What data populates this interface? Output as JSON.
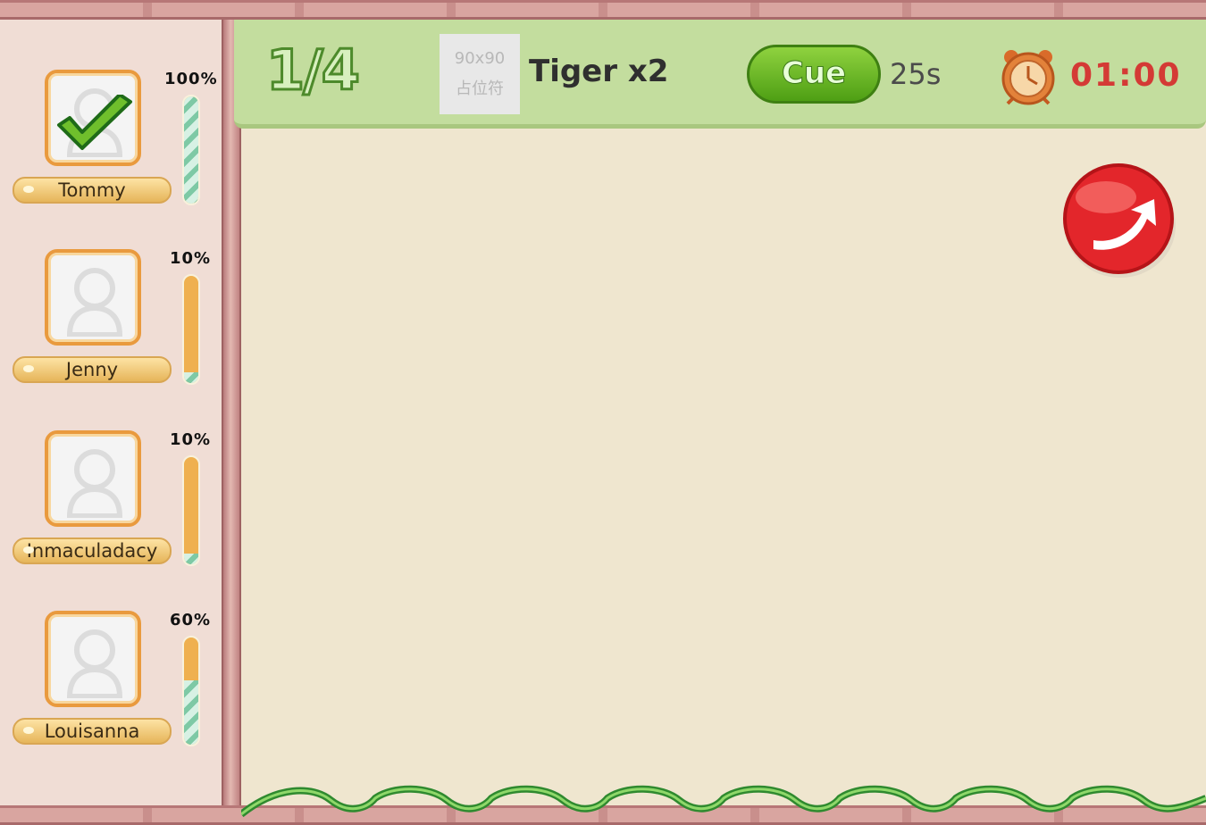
{
  "header": {
    "progress": "1/4",
    "placeholder_line1": "90x90",
    "placeholder_line2": "占位符",
    "word": "Tiger x2",
    "cue_label": "Cue",
    "cue_count": "25s",
    "timer": "01:00",
    "clock_icon": "alarm-clock-icon",
    "exit_icon": "exit-arrow-icon"
  },
  "players": [
    {
      "name": "Tommy",
      "percent_label": "100%",
      "progress": 1.0,
      "done": true
    },
    {
      "name": "Jenny",
      "percent_label": "10%",
      "progress": 0.1,
      "done": false
    },
    {
      "name": "Inmaculadacy",
      "percent_label": "10%",
      "progress": 0.1,
      "done": false
    },
    {
      "name": "Louisanna",
      "percent_label": "60%",
      "progress": 0.6,
      "done": false
    }
  ],
  "colors": {
    "header_bg": "#c3dd9e",
    "cue_green": "#5fb11e",
    "timer_red": "#d43a35",
    "exit_red": "#e3262b",
    "bar_orange": "#efb04f",
    "bar_fill_teal": "#7ec9a5"
  }
}
